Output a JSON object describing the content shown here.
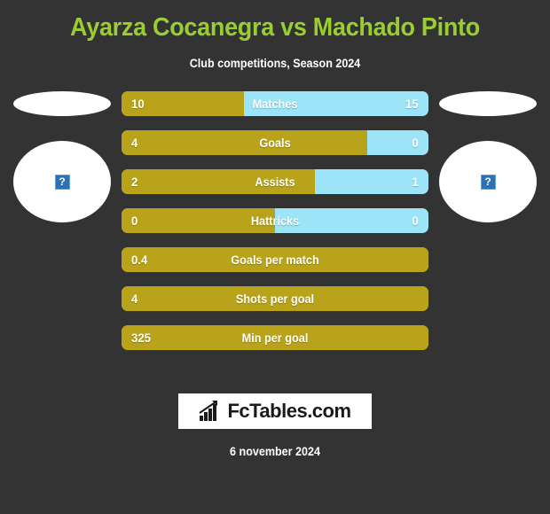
{
  "header": {
    "title": "Ayarza Cocanegra vs Machado Pinto",
    "subtitle": "Club competitions, Season 2024",
    "title_color": "#9acd32"
  },
  "players": {
    "home": {
      "flag_icon": "flag-placeholder",
      "photo_icon": "broken-image-icon",
      "broken_glyph": "?"
    },
    "away": {
      "flag_icon": "flag-placeholder",
      "photo_icon": "broken-image-icon",
      "broken_glyph": "?"
    }
  },
  "colors": {
    "background": "#333333",
    "home_bar": "#b8a31a",
    "away_bar": "#9ce4f7",
    "accent": "#9acd32"
  },
  "stats": [
    {
      "label": "Matches",
      "home": "10",
      "away": "15",
      "home_percent": 40,
      "single_sided": false
    },
    {
      "label": "Goals",
      "home": "4",
      "away": "0",
      "home_percent": 80,
      "single_sided": false
    },
    {
      "label": "Assists",
      "home": "2",
      "away": "1",
      "home_percent": 63,
      "single_sided": false
    },
    {
      "label": "Hattricks",
      "home": "0",
      "away": "0",
      "home_percent": 50,
      "single_sided": false
    },
    {
      "label": "Goals per match",
      "home": "0.4",
      "away": "",
      "home_percent": 100,
      "single_sided": true
    },
    {
      "label": "Shots per goal",
      "home": "4",
      "away": "",
      "home_percent": 100,
      "single_sided": true
    },
    {
      "label": "Min per goal",
      "home": "325",
      "away": "",
      "home_percent": 100,
      "single_sided": true
    }
  ],
  "footer": {
    "logo_text": "FcTables.com",
    "logo_icon": "bar-chart-icon",
    "date": "6 november 2024"
  }
}
